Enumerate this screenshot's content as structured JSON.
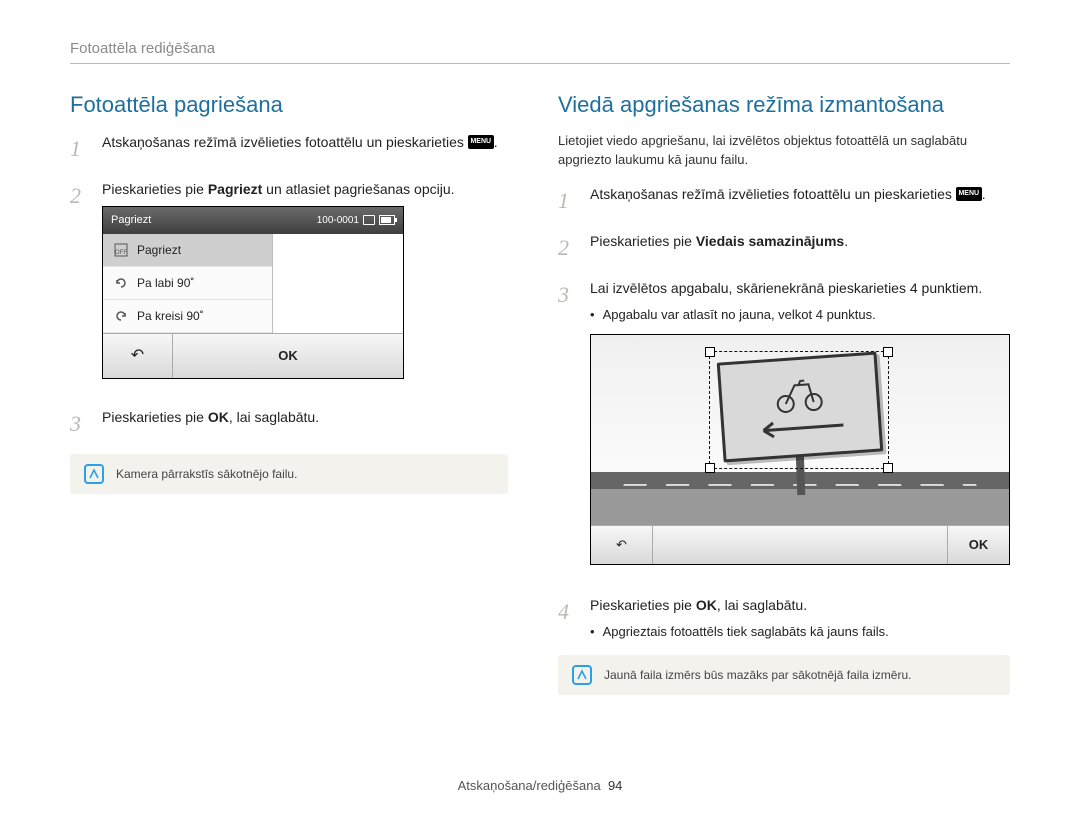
{
  "header": {
    "title": "Fotoattēla rediģēšana"
  },
  "left": {
    "title": "Fotoattēla pagriešana",
    "step1_a": "Atskaņošanas režīmā izvēlieties fotoattēlu un pieskarieties ",
    "step1_b": ".",
    "menu_chip": "MENU",
    "step2_a": "Pieskarieties pie ",
    "step2_bold": "Pagriezt",
    "step2_b": " un atlasiet pagriešanas opciju.",
    "ui": {
      "title": "Pagriezt",
      "counter": "100-0001",
      "items": [
        "Pagriezt",
        "Pa labi 90˚",
        "Pa kreisi 90˚"
      ],
      "back": "↩",
      "ok": "OK"
    },
    "step3_a": "Pieskarieties pie ",
    "step3_b": ", lai saglabātu.",
    "ok_label": "OK",
    "note": "Kamera pārrakstīs sākotnējo failu."
  },
  "right": {
    "title": "Viedā apgriešanas režīma izmantošana",
    "intro": "Lietojiet viedo apgriešanu, lai izvēlētos objektus fotoattēlā un saglabātu apgriezto laukumu kā jaunu failu.",
    "step1_a": "Atskaņošanas režīmā izvēlieties fotoattēlu un pieskarieties ",
    "step1_b": ".",
    "menu_chip": "MENU",
    "step2_a": "Pieskarieties pie ",
    "step2_bold": "Viedais samazinājums",
    "step2_b": ".",
    "step3": "Lai izvēlētos apgabalu, skārienekrānā pieskarieties 4 punktiem.",
    "step3_bullet": "Apgabalu var atlasīt no jauna, velkot 4 punktus.",
    "ui": {
      "back": "↩",
      "ok": "OK"
    },
    "step4_a": "Pieskarieties pie ",
    "step4_b": ", lai saglabātu.",
    "ok_label": "OK",
    "step4_bullet": "Apgrieztais fotoattēls tiek saglabāts kā jauns fails.",
    "note": "Jaunā faila izmērs būs mazāks par sākotnējā faila izmēru."
  },
  "footer": {
    "section": "Atskaņošana/rediģēšana",
    "page": "94"
  }
}
